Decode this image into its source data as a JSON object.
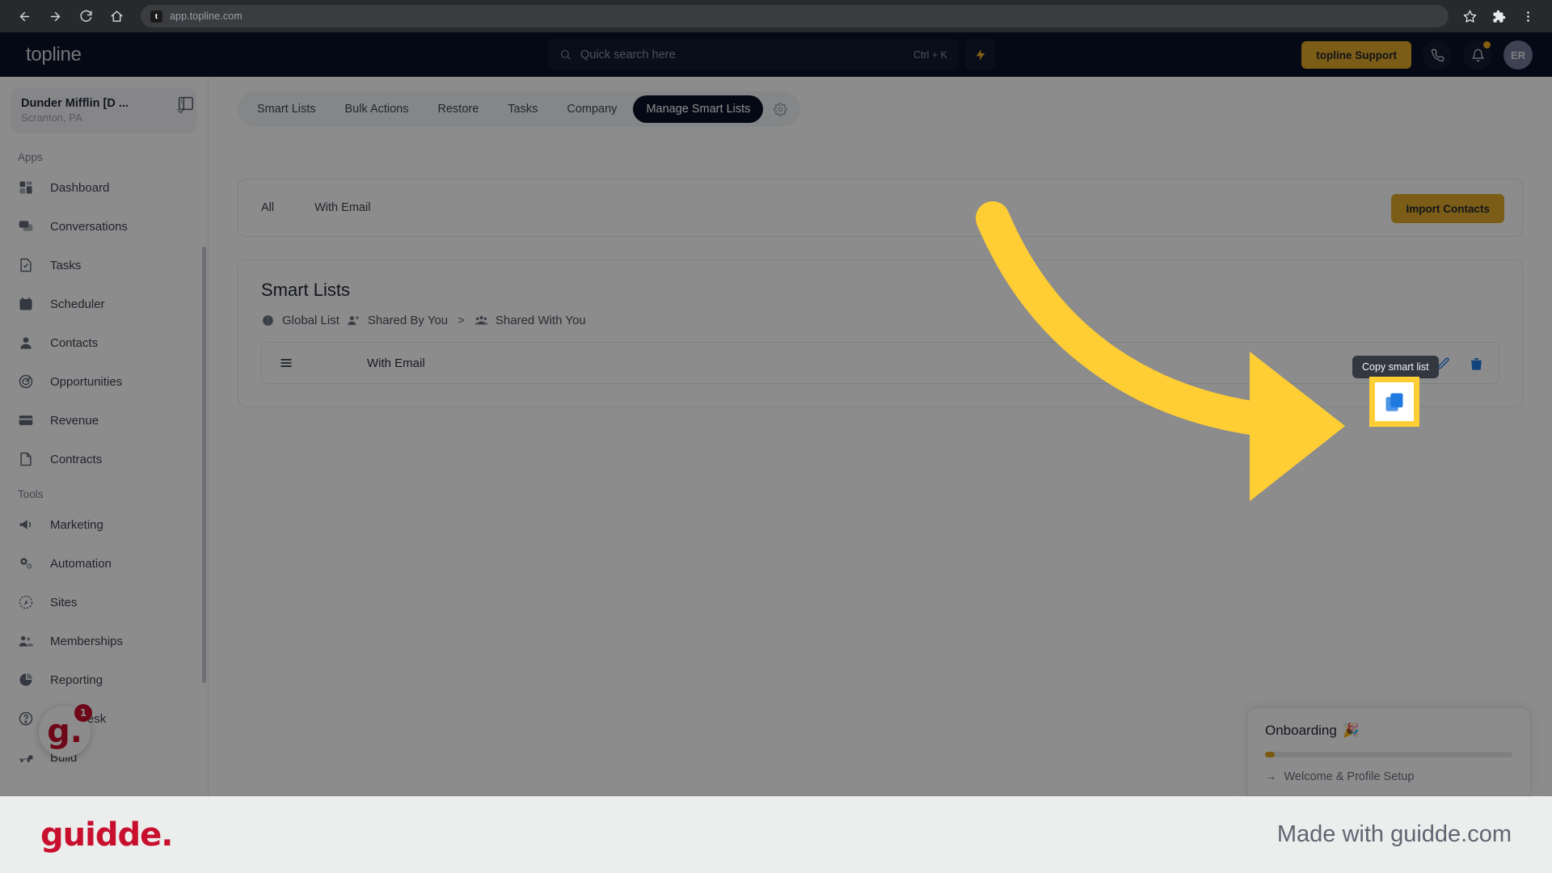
{
  "browser": {
    "back_icon": "arrow-left-icon",
    "forward_icon": "arrow-right-icon",
    "reload_icon": "reload-icon",
    "home_icon": "home-icon",
    "favicon_letter": "t",
    "url": "app.topline.com",
    "bookmark_icon": "star-icon",
    "extensions_icon": "puzzle-icon",
    "menu_icon": "kebab-menu-icon"
  },
  "header": {
    "logo": "topline",
    "search": {
      "placeholder": "Quick search here",
      "shortcut": "Ctrl + K"
    },
    "bolt_label": "quick-actions",
    "support_button": "topline Support",
    "phone_label": "phone",
    "notification_label": "notifications",
    "avatar_initials": "ER"
  },
  "sidebar": {
    "org_name": "Dunder Mifflin [D ...",
    "org_location": "Scranton, PA",
    "sections": [
      {
        "label": "Apps",
        "items": [
          {
            "label": "Dashboard",
            "icon": "dashboard-icon"
          },
          {
            "label": "Conversations",
            "icon": "chat-icon"
          },
          {
            "label": "Tasks",
            "icon": "task-icon"
          },
          {
            "label": "Scheduler",
            "icon": "calendar-icon"
          },
          {
            "label": "Contacts",
            "icon": "user-icon"
          },
          {
            "label": "Opportunities",
            "icon": "target-icon"
          },
          {
            "label": "Revenue",
            "icon": "card-icon"
          },
          {
            "label": "Contracts",
            "icon": "document-icon"
          }
        ]
      },
      {
        "label": "Tools",
        "items": [
          {
            "label": "Marketing",
            "icon": "megaphone-icon"
          },
          {
            "label": "Automation",
            "icon": "gear-icon"
          },
          {
            "label": "Sites",
            "icon": "globe-icon"
          },
          {
            "label": "Memberships",
            "icon": "people-icon"
          },
          {
            "label": "Reporting",
            "icon": "pie-chart-icon"
          },
          {
            "label": "Help Desk",
            "icon": "help-icon"
          },
          {
            "label": "Build",
            "icon": "build-icon"
          }
        ]
      }
    ]
  },
  "guidde_widget": {
    "letter": "g.",
    "badge": "1"
  },
  "main": {
    "tabs": [
      {
        "label": "Smart Lists",
        "active": false
      },
      {
        "label": "Bulk Actions",
        "active": false
      },
      {
        "label": "Restore",
        "active": false
      },
      {
        "label": "Tasks",
        "active": false
      },
      {
        "label": "Company",
        "active": false
      },
      {
        "label": "Manage Smart Lists",
        "active": true
      }
    ],
    "tab_settings_icon": "gear-icon",
    "filters": {
      "tabs": [
        "All",
        "With Email"
      ],
      "import_button": "Import Contacts"
    },
    "smart_lists": {
      "title": "Smart Lists",
      "breadcrumb": [
        {
          "label": "Global List",
          "icon": "globe-small-icon"
        },
        {
          "label": "Shared By You",
          "icon": "user-add-icon"
        },
        {
          "label": "Shared With You",
          "icon": "users-icon"
        }
      ],
      "breadcrumb_separator": ">",
      "rows": [
        {
          "name": "With Email",
          "drag_icon": "drag-handle-icon",
          "actions": [
            "copy-icon",
            "share-icon",
            "edit-icon",
            "delete-icon"
          ]
        }
      ],
      "tooltip": "Copy smart list"
    }
  },
  "onboarding": {
    "title": "Onboarding",
    "title_emoji": "🎉",
    "progress_percent": 2,
    "step": "Welcome & Profile Setup",
    "step_arrow": "→"
  },
  "footer": {
    "logo": "guidde.",
    "made_with": "Made with guidde.com"
  },
  "colors": {
    "accent_gold": "#e0a92a",
    "highlight_yellow": "#ffce34",
    "header_navy": "#0a1127",
    "action_blue": "#1f7ae0",
    "guidde_red": "#c8102e"
  }
}
